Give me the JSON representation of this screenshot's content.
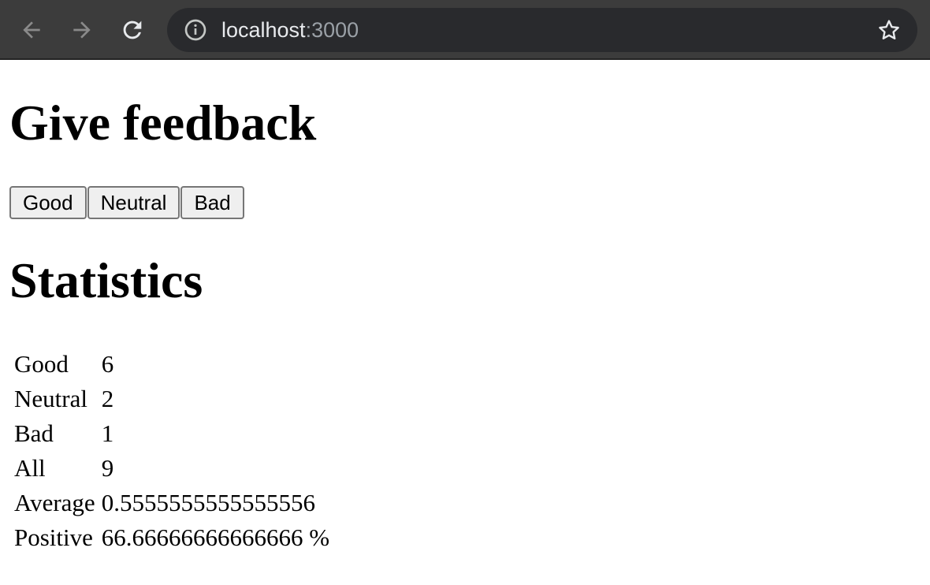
{
  "browser": {
    "url_host": "localhost",
    "url_port": ":3000",
    "icons": [
      "back-arrow-icon",
      "forward-arrow-icon",
      "reload-icon",
      "info-icon",
      "star-icon"
    ],
    "toolbar_color": "#3c3c3c",
    "omnibox_color": "#292a2d"
  },
  "feedback": {
    "heading": "Give feedback",
    "buttons": {
      "good": "Good",
      "neutral": "Neutral",
      "bad": "Bad"
    }
  },
  "statistics": {
    "heading": "Statistics",
    "rows": [
      {
        "label": "Good",
        "value": "6"
      },
      {
        "label": "Neutral",
        "value": "2"
      },
      {
        "label": "Bad",
        "value": "1"
      },
      {
        "label": "All",
        "value": "9"
      },
      {
        "label": "Average",
        "value": "0.5555555555555556"
      },
      {
        "label": "Positive",
        "value": "66.66666666666666 %"
      }
    ]
  }
}
